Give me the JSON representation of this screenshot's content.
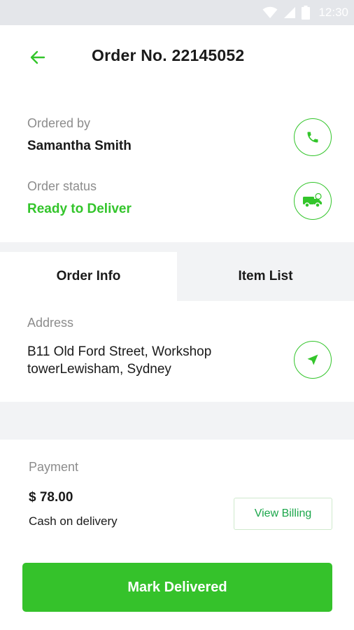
{
  "status_bar": {
    "time": "12:30",
    "icons": [
      "wifi-icon",
      "signal-icon",
      "battery-icon"
    ]
  },
  "header": {
    "title": "Order No. 22145052",
    "back_icon": "arrow-left-icon"
  },
  "customer": {
    "label": "Ordered by",
    "name": "Samantha Smith",
    "action_icon": "phone-icon"
  },
  "order_status": {
    "label": "Order status",
    "value": "Ready to Deliver",
    "action_icon": "delivery-truck-icon"
  },
  "tabs": [
    {
      "label": "Order Info",
      "active": true
    },
    {
      "label": "Item List",
      "active": false
    }
  ],
  "address": {
    "label": "Address",
    "line1": "B11 Old Ford Street, Workshop",
    "line2": "towerLewisham, Sydney",
    "action_icon": "navigation-arrow-icon"
  },
  "payment": {
    "label": "Payment",
    "amount": "$ 78.00",
    "method": "Cash on delivery",
    "billing_button": "View Billing"
  },
  "primary_action": {
    "label": "Mark Delivered"
  },
  "colors": {
    "accent": "#33c52b",
    "cta": "#35c22b",
    "band": "#f2f3f5",
    "status_bar": "#e4e6ea"
  }
}
